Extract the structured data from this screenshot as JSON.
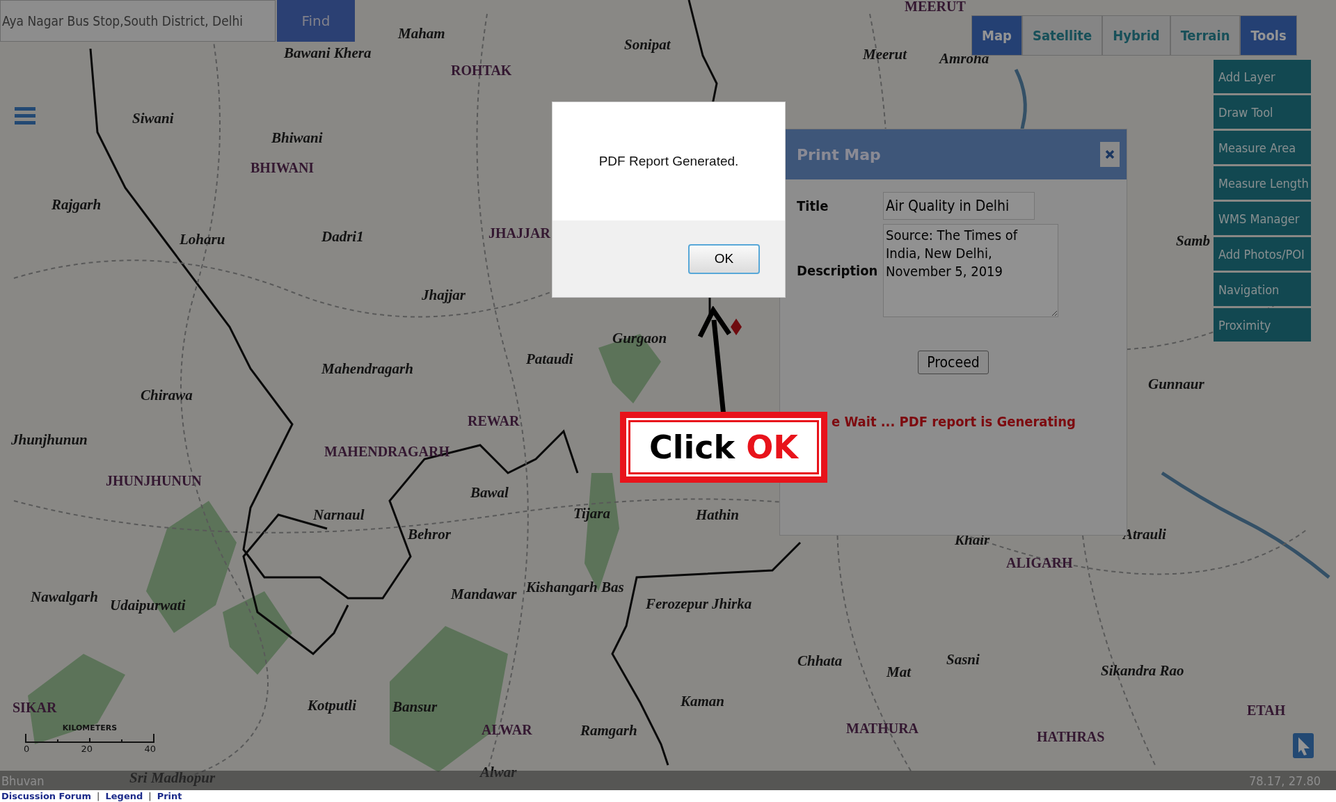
{
  "search": {
    "value": "Aya Nagar Bus Stop,South District, Delhi",
    "button": "Find"
  },
  "map_types": [
    {
      "label": "Map",
      "selected": true
    },
    {
      "label": "Satellite",
      "selected": false
    },
    {
      "label": "Hybrid",
      "selected": false
    },
    {
      "label": "Terrain",
      "selected": false
    }
  ],
  "tools": {
    "label": "Tools",
    "expanded": true,
    "items": [
      "Add Layer",
      "Draw Tool",
      "Measure Area",
      "Measure Length",
      "WMS Manager",
      "Add Photos/POI",
      "Navigation",
      "Proximity"
    ]
  },
  "map_labels": [
    {
      "text": "MEERUT",
      "kind": "district"
    },
    {
      "text": "Maham",
      "kind": "town"
    },
    {
      "text": "Bawani Khera",
      "kind": "town"
    },
    {
      "text": "Sonipat",
      "kind": "town"
    },
    {
      "text": "ROHTAK",
      "kind": "district"
    },
    {
      "text": "Meerut",
      "kind": "town"
    },
    {
      "text": "Amroha",
      "kind": "town"
    },
    {
      "text": "Siwani",
      "kind": "town"
    },
    {
      "text": "Bhiwani",
      "kind": "town"
    },
    {
      "text": "BHIWANI",
      "kind": "district"
    },
    {
      "text": "Rajgarh",
      "kind": "town"
    },
    {
      "text": "Loharu",
      "kind": "town"
    },
    {
      "text": "Dadri1",
      "kind": "town"
    },
    {
      "text": "JHAJJAR",
      "kind": "district"
    },
    {
      "text": "Jhajjar",
      "kind": "town"
    },
    {
      "text": "Mahendragarh",
      "kind": "town"
    },
    {
      "text": "Gurgaon",
      "kind": "town"
    },
    {
      "text": "Pataudi",
      "kind": "town"
    },
    {
      "text": "Chirawa",
      "kind": "town"
    },
    {
      "text": "REWAR",
      "kind": "district"
    },
    {
      "text": "Jhunjhunun",
      "kind": "town"
    },
    {
      "text": "MAHENDRAGARH",
      "kind": "district"
    },
    {
      "text": "JHUNJHUNUN",
      "kind": "district"
    },
    {
      "text": "Bawal",
      "kind": "town"
    },
    {
      "text": "Narnaul",
      "kind": "town"
    },
    {
      "text": "Tijara",
      "kind": "town"
    },
    {
      "text": "Hathin",
      "kind": "town"
    },
    {
      "text": "Behror",
      "kind": "town"
    },
    {
      "text": "Nawalgarh",
      "kind": "town"
    },
    {
      "text": "Udaipurwati",
      "kind": "town"
    },
    {
      "text": "Mandawar",
      "kind": "town"
    },
    {
      "text": "Kishangarh Bas",
      "kind": "town"
    },
    {
      "text": "Ferozepur Jhirka",
      "kind": "town"
    },
    {
      "text": "Chhata",
      "kind": "town"
    },
    {
      "text": "Mat",
      "kind": "town"
    },
    {
      "text": "Sasni",
      "kind": "town"
    },
    {
      "text": "Sikandra Rao",
      "kind": "town"
    },
    {
      "text": "ALIGARH",
      "kind": "district"
    },
    {
      "text": "Khair",
      "kind": "town"
    },
    {
      "text": "Atrauli",
      "kind": "town"
    },
    {
      "text": "Samb",
      "kind": "town"
    },
    {
      "text": "Gunnaur",
      "kind": "town"
    },
    {
      "text": "SIKAR",
      "kind": "district"
    },
    {
      "text": "Kotputli",
      "kind": "town"
    },
    {
      "text": "Bansur",
      "kind": "town"
    },
    {
      "text": "ALWAR",
      "kind": "district"
    },
    {
      "text": "Ramgarh",
      "kind": "town"
    },
    {
      "text": "Kaman",
      "kind": "town"
    },
    {
      "text": "MATHURA",
      "kind": "district"
    },
    {
      "text": "HATHRAS",
      "kind": "district"
    },
    {
      "text": "ETAH",
      "kind": "district"
    },
    {
      "text": "Sri Madhopur",
      "kind": "town"
    },
    {
      "text": "Alwar",
      "kind": "town"
    }
  ],
  "scale": {
    "unit": "KILOMETERS",
    "ticks": [
      "0",
      "20",
      "40"
    ]
  },
  "print_map": {
    "title": "Print Map",
    "fields": [
      {
        "label": "Title",
        "value": "Air Quality in Delhi",
        "kind": "input"
      },
      {
        "label": "Description",
        "value": "Source: The Times of India, New Delhi, November 5, 2019",
        "kind": "textarea"
      }
    ],
    "button": "Proceed",
    "status": "e Wait ... PDF report is Generating"
  },
  "alert": {
    "message": "PDF Report Generated.",
    "button": "OK"
  },
  "callout": {
    "text": "Click",
    "highlight": "OK"
  },
  "status_bar": {
    "left": "Bhuvan",
    "coordinates": "78.17, 27.80"
  },
  "footer": [
    {
      "text": "Discussion Forum",
      "kind": "link"
    },
    {
      "text": "|",
      "kind": "separator"
    },
    {
      "text": "Legend",
      "kind": "link"
    },
    {
      "text": "|",
      "kind": "separator"
    },
    {
      "text": "Print",
      "kind": "link"
    }
  ]
}
